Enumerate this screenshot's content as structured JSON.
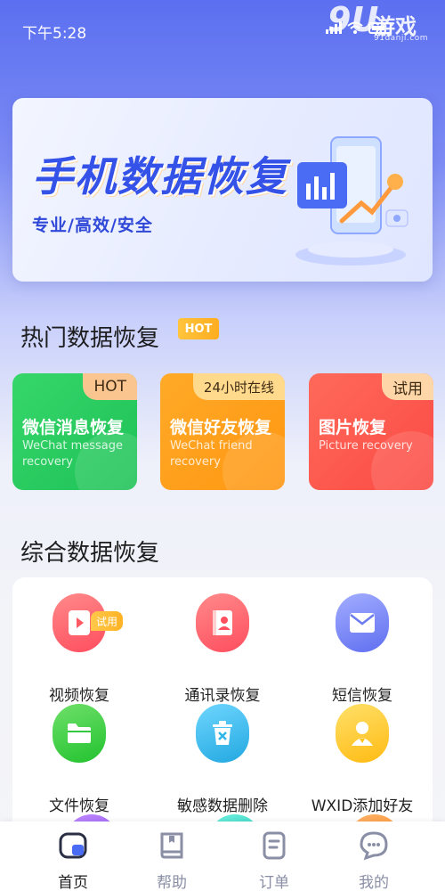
{
  "status_bar": {
    "time": "下午5:28",
    "watermark_num": "9U",
    "watermark_text": "游戏",
    "watermark_sub": "91danji.com"
  },
  "banner": {
    "title": "手机数据恢复",
    "subtitle": "专业/高效/安全"
  },
  "hot_section": {
    "title": "热门数据恢复",
    "badge": "HOT",
    "cards": [
      {
        "tag": "HOT",
        "title": "微信消息恢复",
        "desc": "WeChat message recovery",
        "color": "#28c95e"
      },
      {
        "tag": "24小时在线",
        "title": "微信好友恢复",
        "desc": "WeChat friend recovery",
        "color": "#ff9e1a"
      },
      {
        "tag": "试用",
        "title": "图片恢复",
        "desc": "Picture recovery",
        "color": "#fd5548"
      }
    ]
  },
  "general_section": {
    "title": "综合数据恢复",
    "items": [
      {
        "label": "视频恢复",
        "badge": "试用",
        "color": "#ff5a64",
        "icon": "video-icon"
      },
      {
        "label": "通讯录恢复",
        "color": "#ff5060",
        "icon": "contacts-icon"
      },
      {
        "label": "短信恢复",
        "color": "#6c7cf0",
        "icon": "message-icon"
      },
      {
        "label": "文件恢复",
        "color": "#34c93f",
        "icon": "folder-icon"
      },
      {
        "label": "敏感数据删除",
        "color": "#2fb6e8",
        "icon": "trash-icon"
      },
      {
        "label": "WXID添加好友",
        "color": "#ffc21a",
        "icon": "user-add-icon"
      }
    ]
  },
  "bottom_nav": [
    {
      "label": "首页",
      "icon": "home-icon",
      "active": true
    },
    {
      "label": "帮助",
      "icon": "book-icon",
      "active": false
    },
    {
      "label": "订单",
      "icon": "order-icon",
      "active": false
    },
    {
      "label": "我的",
      "icon": "chat-icon",
      "active": false
    }
  ]
}
